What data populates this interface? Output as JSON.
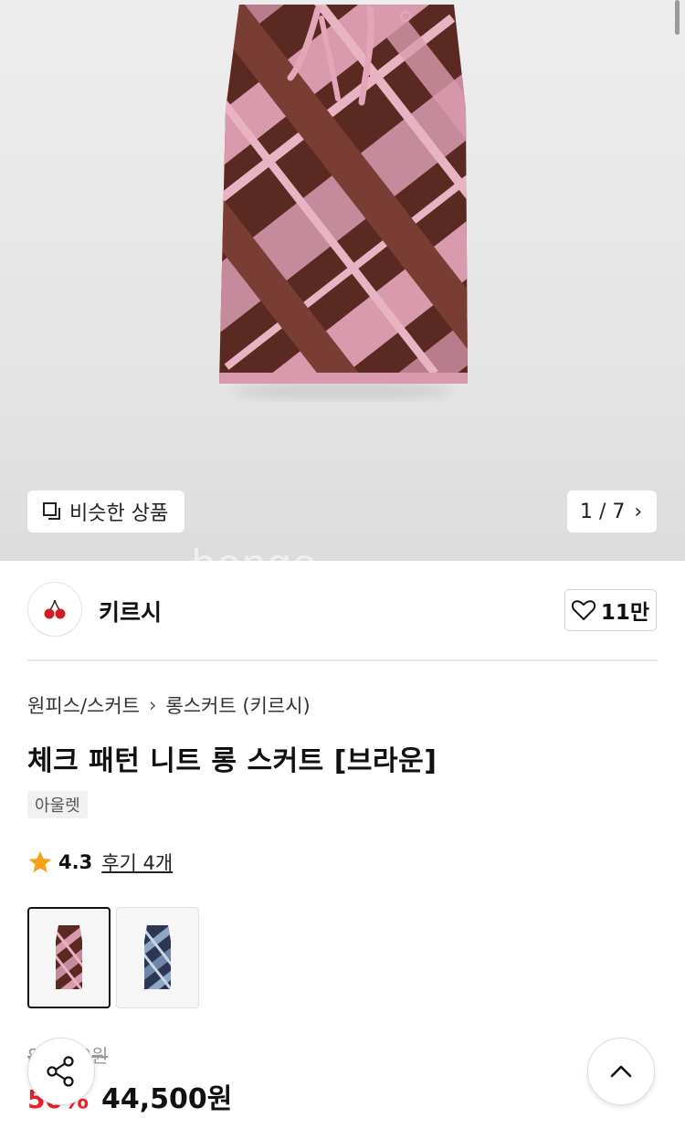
{
  "gallery": {
    "similar_label": "비슷한 상품",
    "counter": "1 / 7",
    "watermark": "bongo"
  },
  "brand": {
    "name": "키르시",
    "likes": "11만"
  },
  "product": {
    "breadcrumb": [
      "원피스/스커트",
      "롱스커트 (키르시)"
    ],
    "title": "체크 패턴 니트 롱 스커트 [브라운]",
    "badge": "아울렛",
    "rating": "4.3",
    "reviews": "후기 4개",
    "original_price": "89,000원",
    "discount": "50%",
    "price": "44,500원"
  },
  "variants": [
    {
      "name": "brown",
      "selected": true
    },
    {
      "name": "navy",
      "selected": false
    }
  ],
  "colors": {
    "accent_red": "#e8232b",
    "star": "#f6a11a",
    "skirt_brown": "#5a2a22",
    "skirt_pink": "#d99aae"
  }
}
